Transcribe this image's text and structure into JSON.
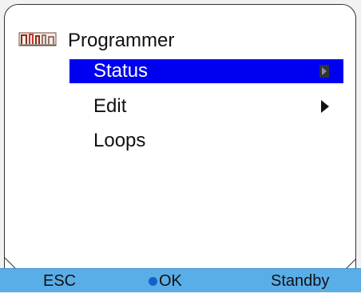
{
  "menu": {
    "title": "Programmer",
    "icon": "programmer-icon",
    "items": [
      {
        "label": "Status",
        "selected": true,
        "has_submenu": true
      },
      {
        "label": "Edit",
        "selected": false,
        "has_submenu": true
      },
      {
        "label": "Loops",
        "selected": false,
        "has_submenu": false
      }
    ]
  },
  "softkeys": {
    "esc_label": "ESC",
    "ok_label": "OK",
    "standby_label": "Standby"
  },
  "colors": {
    "selection": "#0000f0",
    "softkey_bar": "#5aaee8",
    "ok_dot": "#1560c8"
  }
}
